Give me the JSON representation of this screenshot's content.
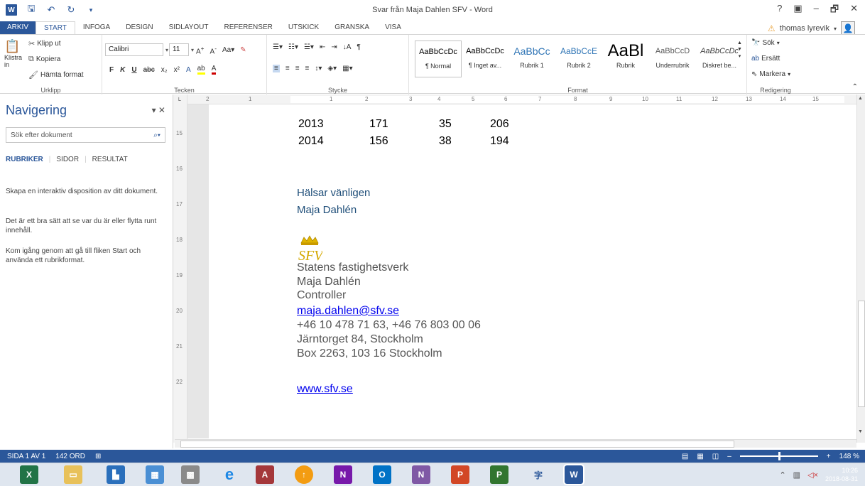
{
  "window": {
    "title": "Svar från Maja Dahlen SFV - Word",
    "help": "?",
    "minimize": "–",
    "restore": "🗗",
    "close": "✕"
  },
  "tabs": [
    "ARKIV",
    "START",
    "INFOGA",
    "DESIGN",
    "SIDLAYOUT",
    "REFERENSER",
    "UTSKICK",
    "GRANSKA",
    "VISA"
  ],
  "user": {
    "name": "thomas lyrevik"
  },
  "ribbon": {
    "clipboard": {
      "paste": "Klistra in",
      "cut": "Klipp ut",
      "copy": "Kopiera",
      "format_painter": "Hämta format",
      "label": "Urklipp"
    },
    "font": {
      "name": "Calibri",
      "size": "11",
      "label": "Tecken"
    },
    "paragraph": {
      "label": "Stycke"
    },
    "styles": {
      "label": "Format",
      "items": [
        {
          "preview": "AaBbCcDc",
          "name": "¶ Normal"
        },
        {
          "preview": "AaBbCcDc",
          "name": "¶ Inget av..."
        },
        {
          "preview": "AaBbCc",
          "name": "Rubrik 1"
        },
        {
          "preview": "AaBbCcE",
          "name": "Rubrik 2"
        },
        {
          "preview": "AaBl",
          "name": "Rubrik"
        },
        {
          "preview": "AaBbCcD",
          "name": "Underrubrik"
        },
        {
          "preview": "AaBbCcDc",
          "name": "Diskret be..."
        }
      ]
    },
    "editing": {
      "find": "Sök",
      "replace": "Ersätt",
      "select": "Markera",
      "label": "Redigering"
    }
  },
  "nav": {
    "title": "Navigering",
    "search_placeholder": "Sök efter dokument",
    "tabs": [
      "RUBRIKER",
      "SIDOR",
      "RESULTAT"
    ],
    "p1": "Skapa en interaktiv disposition av ditt dokument.",
    "p2": "Det är ett bra sätt att se var du är eller flytta runt innehåll.",
    "p3": "Kom igång genom att gå till fliken Start och använda ett rubrikformat."
  },
  "ruler": {
    "h": [
      "2",
      "1",
      "1",
      "2",
      "3",
      "4",
      "5",
      "6",
      "7",
      "8",
      "9",
      "10",
      "11",
      "12",
      "13",
      "14",
      "15"
    ],
    "v": [
      "15",
      "16",
      "17",
      "18",
      "19",
      "20",
      "21",
      "22"
    ]
  },
  "document": {
    "rows": [
      [
        "2013",
        "171",
        "35",
        "206"
      ],
      [
        "2014",
        "156",
        "38",
        "194"
      ]
    ],
    "greeting": "Hälsar vänligen",
    "sender": "Maja Dahlén",
    "logo_text": "SFV",
    "org": "Statens fastighetsverk",
    "name": "Maja Dahlén",
    "role": "Controller",
    "email": "maja.dahlen@sfv.se",
    "phone": "+46 10 478 71 63, +46 76 803 00 06",
    "address1": "Järntorget 84, Stockholm",
    "address2": "Box 2263, 103 16 Stockholm",
    "web": "www.sfv.se"
  },
  "status": {
    "page": "SIDA 1 AV 1",
    "words": "142 ORD",
    "zoom": "148 %"
  },
  "taskbar": {
    "time": "10:26",
    "date": "2018-08-31"
  }
}
